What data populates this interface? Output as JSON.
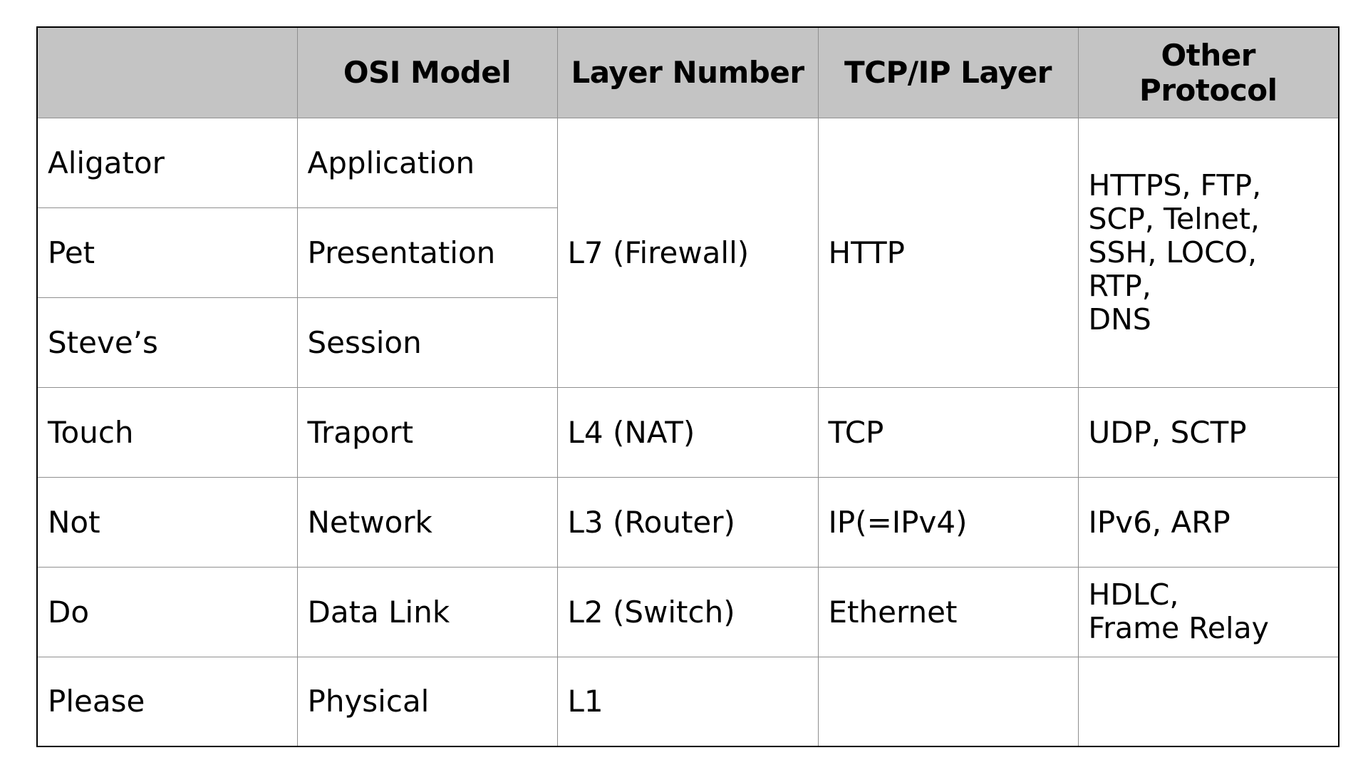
{
  "table": {
    "headers": [
      "",
      "OSI Model",
      "Layer Number",
      "TCP/IP Layer",
      "Other Protocol"
    ],
    "rows": [
      {
        "mnemonic": "Aligator",
        "osi_layer": "Application",
        "layer_number": "L7 (Firewall)",
        "tcpip_layer": "HTTP",
        "other_protocol": "HTTPS, FTP,\nSCP, Telnet,\nSSH, LOCO, RTP,\nDNS"
      },
      {
        "mnemonic": "Pet",
        "osi_layer": "Presentation"
      },
      {
        "mnemonic": "Steve’s",
        "osi_layer": "Session"
      },
      {
        "mnemonic": "Touch",
        "osi_layer": "Traport",
        "layer_number": "L4 (NAT)",
        "tcpip_layer": "TCP",
        "other_protocol": "UDP, SCTP"
      },
      {
        "mnemonic": "Not",
        "osi_layer": "Network",
        "layer_number": "L3 (Router)",
        "tcpip_layer": "IP(=IPv4)",
        "other_protocol": "IPv6, ARP"
      },
      {
        "mnemonic": "Do",
        "osi_layer": "Data Link",
        "layer_number": "L2 (Switch)",
        "tcpip_layer": "Ethernet",
        "other_protocol": "HDLC,\nFrame Relay"
      },
      {
        "mnemonic": "Please",
        "osi_layer": "Physical",
        "layer_number": "L1",
        "tcpip_layer": "",
        "other_protocol": ""
      }
    ]
  }
}
